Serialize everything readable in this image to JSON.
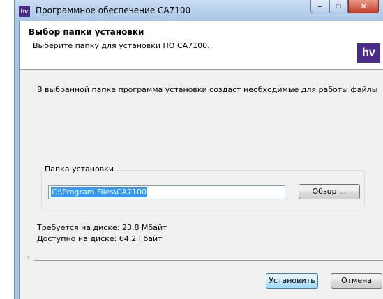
{
  "window": {
    "title": "Программное обеспечение CA7100",
    "icon_text": "hv",
    "controls": {
      "minimize": "–",
      "maximize": "□",
      "close": "✕"
    }
  },
  "header": {
    "title": "Выбор папки установки",
    "subtitle": "Выберите папку для установки ПО CA7100.",
    "logo_text": "hv"
  },
  "body": {
    "info": "В выбранной папке программа установки создаст необходимые для работы файлы"
  },
  "install_folder": {
    "group_label": "Папка установки",
    "path_value": "C:\\Program Files\\CA7100",
    "browse_label": "Обзор ..."
  },
  "disk": {
    "required": "Требуется на диске: 23.8 Мбайт",
    "available": "Доступно на диске: 64.2 Гбайт"
  },
  "footer": {
    "separator_mark": "*",
    "install_label": "Установить",
    "cancel_label": "Отмена"
  },
  "colors": {
    "frame": "#a9c6e6",
    "logo": "#4b2a8a",
    "selection": "#3399ff"
  }
}
